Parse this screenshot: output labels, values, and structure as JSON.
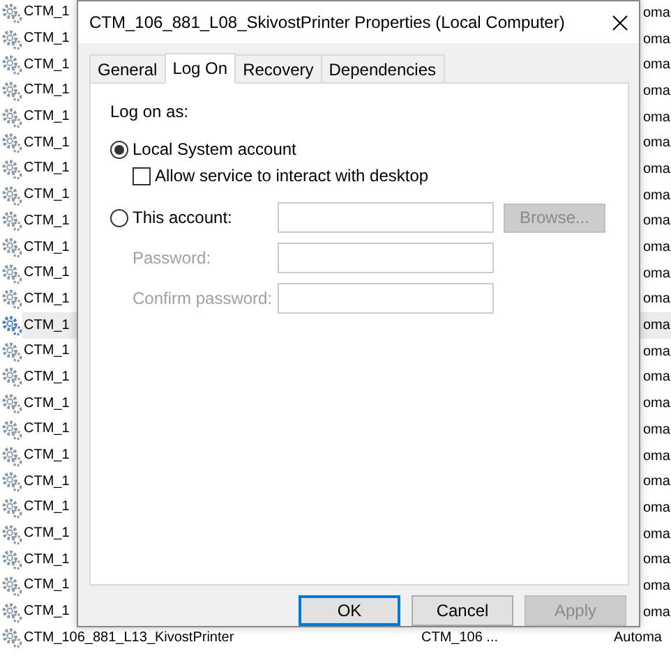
{
  "services": [
    {
      "name": "CTM_1",
      "column_3": "oma",
      "selected": false
    },
    {
      "name": "CTM_1",
      "column_3": "oma",
      "selected": false
    },
    {
      "name": "CTM_1",
      "column_3": "oma",
      "selected": false
    },
    {
      "name": "CTM_1",
      "column_3": "oma",
      "selected": false
    },
    {
      "name": "CTM_1",
      "column_3": "oma",
      "selected": false
    },
    {
      "name": "CTM_1",
      "column_3": "oma",
      "selected": false
    },
    {
      "name": "CTM_1",
      "column_3": "oma",
      "selected": false
    },
    {
      "name": "CTM_1",
      "column_3": "oma",
      "selected": false
    },
    {
      "name": "CTM_1",
      "column_3": "oma",
      "selected": false
    },
    {
      "name": "CTM_1",
      "column_3": "oma",
      "selected": false
    },
    {
      "name": "CTM_1",
      "column_3": "oma",
      "selected": false
    },
    {
      "name": "CTM_1",
      "column_3": "oma",
      "selected": false
    },
    {
      "name": "CTM_1",
      "column_3": "oma",
      "selected": true
    },
    {
      "name": "CTM_1",
      "column_3": "oma",
      "selected": false
    },
    {
      "name": "CTM_1",
      "column_3": "oma",
      "selected": false
    },
    {
      "name": "CTM_1",
      "column_3": "oma",
      "selected": false
    },
    {
      "name": "CTM_1",
      "column_3": "oma",
      "selected": false
    },
    {
      "name": "CTM_1",
      "column_3": "oma",
      "selected": false
    },
    {
      "name": "CTM_1",
      "column_3": "oma",
      "selected": false
    },
    {
      "name": "CTM_1",
      "column_3": "oma",
      "selected": false
    },
    {
      "name": "CTM_1",
      "column_3": "oma",
      "selected": false
    },
    {
      "name": "CTM_1",
      "column_3": "oma",
      "selected": false
    },
    {
      "name": "CTM_1",
      "column_3": "oma",
      "selected": false
    },
    {
      "name": "CTM_1",
      "column_3": "oma",
      "selected": false
    },
    {
      "name": "CTM_106_881_L13_KivostPrinter",
      "column_2": "CTM_106 ...",
      "column_3": "Automa",
      "selected": false
    }
  ],
  "dialog": {
    "title": "CTM_106_881_L08_SkivostPrinter Properties (Local Computer)",
    "tabs": [
      {
        "label": "General",
        "selected": false
      },
      {
        "label": "Log On",
        "selected": true
      },
      {
        "label": "Recovery",
        "selected": false
      },
      {
        "label": "Dependencies",
        "selected": false
      }
    ],
    "group_label": "Log on as:",
    "local_system": {
      "label": "Local System account",
      "selected": true
    },
    "interact_checkbox": {
      "label": "Allow service to interact with desktop",
      "checked": false
    },
    "this_account": {
      "label": "This account:",
      "selected": false
    },
    "browse_button": {
      "label": "Browse...",
      "disabled": true
    },
    "fields": [
      {
        "label": "Password:",
        "disabled": true
      },
      {
        "label": "Confirm password:",
        "disabled": true
      }
    ],
    "buttons": [
      {
        "label": "OK",
        "default": true,
        "disabled": false
      },
      {
        "label": "Cancel",
        "default": false,
        "disabled": false
      },
      {
        "label": "Apply",
        "default": false,
        "disabled": true
      }
    ]
  }
}
